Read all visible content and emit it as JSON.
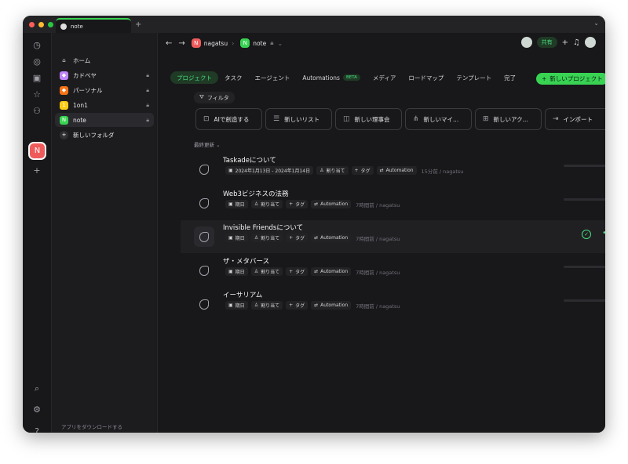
{
  "window": {
    "tab_title": "note"
  },
  "sidebar": {
    "items": [
      {
        "label": "ホーム",
        "icon": "home-icon",
        "locked": false
      },
      {
        "label": "カドベヤ",
        "icon": "workspace-icon",
        "locked": true,
        "color": "#c084fc"
      },
      {
        "label": "パーソナル",
        "icon": "workspace-icon",
        "locked": true,
        "color": "#f97316"
      },
      {
        "label": "1on1",
        "icon": "workspace-icon",
        "locked": true,
        "color": "#facc15"
      },
      {
        "label": "note",
        "icon": "workspace-icon",
        "locked": true,
        "color": "#39d353"
      },
      {
        "label": "新しいフォルダ",
        "icon": "plus-icon",
        "locked": false
      }
    ],
    "download_label": "アプリをダウンロードする"
  },
  "breadcrumb": {
    "workspace": "nagatsu",
    "workspace_initial": "N",
    "folder": "note",
    "folder_initial": "N"
  },
  "header": {
    "share_label": "共有"
  },
  "tabs": [
    {
      "label": "プロジェクト",
      "active": true
    },
    {
      "label": "タスク"
    },
    {
      "label": "エージェント"
    },
    {
      "label": "Automations",
      "badge": "BETA"
    },
    {
      "label": "メディア"
    },
    {
      "label": "ロードマップ"
    },
    {
      "label": "テンプレート"
    },
    {
      "label": "完了"
    }
  ],
  "new_project_label": "新しいプロジェクト",
  "filter_label": "フィルタ",
  "actions": [
    {
      "label": "AIで創造する",
      "icon": "ai-icon"
    },
    {
      "label": "新しいリスト",
      "icon": "list-icon"
    },
    {
      "label": "新しい理事会",
      "icon": "board-icon"
    },
    {
      "label": "新しいマイ...",
      "icon": "mindmap-icon"
    },
    {
      "label": "新しいアク...",
      "icon": "action-icon"
    },
    {
      "label": "インポート",
      "icon": "import-icon"
    }
  ],
  "sort_label": "最終更新",
  "projects": [
    {
      "title": "Taskadeについて",
      "date": "2024年1月13日 - 2024年1月14日",
      "assign": "割り当て",
      "tag": "タグ",
      "automation": "Automation",
      "time": "15分前 / nagatsu"
    },
    {
      "title": "Web3ビジネスの法務",
      "date": "期日",
      "assign": "割り当て",
      "tag": "タグ",
      "automation": "Automation",
      "time": "7時間前 / nagatsu"
    },
    {
      "title": "Invisible Friendsについて",
      "date": "期日",
      "assign": "割り当て",
      "tag": "タグ",
      "automation": "Automation",
      "time": "7時間前 / nagatsu",
      "hover": true
    },
    {
      "title": "ザ・メタバース",
      "date": "期日",
      "assign": "割り当て",
      "tag": "タグ",
      "automation": "Automation",
      "time": "7時間前 / nagatsu"
    },
    {
      "title": "イーサリアム",
      "date": "期日",
      "assign": "割り当て",
      "tag": "タグ",
      "automation": "Automation",
      "time": "7時間前 / nagatsu"
    }
  ],
  "colors": {
    "accent": "#39d353",
    "background": "#18181a",
    "avatar": "#ef5b5b"
  }
}
